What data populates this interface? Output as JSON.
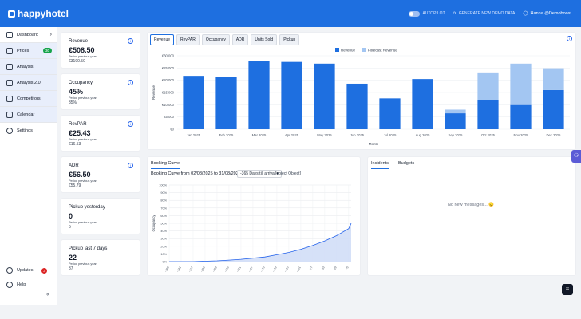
{
  "app": {
    "logo": "happyhotel"
  },
  "topbar": {
    "autopilot_label": "AUTOPILOT",
    "generate_label": "GENERATE NEW DEMO DATA",
    "user_label": "Hanna @Demoboost"
  },
  "sidebar": {
    "items": [
      {
        "label": "Dashboard",
        "icon": "dashboard-icon"
      },
      {
        "label": "Prices",
        "icon": "tag-icon",
        "badge": "30"
      },
      {
        "label": "Analysis",
        "icon": "chart-icon"
      },
      {
        "label": "Analysis 2.0",
        "icon": "chart-icon"
      },
      {
        "label": "Competitors",
        "icon": "competitors-icon"
      },
      {
        "label": "Calendar",
        "icon": "calendar-icon"
      },
      {
        "label": "Settings",
        "icon": "gear-icon"
      }
    ],
    "bottom": [
      {
        "label": "Updates",
        "badge": "3"
      },
      {
        "label": "Help"
      }
    ],
    "collapse_glyph": "«"
  },
  "kpis": [
    {
      "title": "Revenue",
      "value": "€508.50",
      "sub": "Period previous year",
      "prev": "€3190.50"
    },
    {
      "title": "Occupancy",
      "value": "45%",
      "sub": "Period previous year",
      "prev": "35%"
    },
    {
      "title": "RevPAR",
      "value": "€25.43",
      "sub": "Period previous year",
      "prev": "€16.53"
    },
    {
      "title": "ADR",
      "value": "€56.50",
      "sub": "Period previous year",
      "prev": "€55.79"
    },
    {
      "title": "Pickup yesterday",
      "value": "0",
      "sub": "Period previous year",
      "prev": "5"
    },
    {
      "title": "Pickup last 7 days",
      "value": "22",
      "sub": "Period previous year",
      "prev": "37"
    }
  ],
  "revenue_tabs": [
    "Revenue",
    "RevPAR",
    "Occupancy",
    "ADR",
    "Units Sold",
    "Pickup"
  ],
  "booking": {
    "tab": "Booking Curve",
    "title": "Booking Curve from 02/08/2025 to 31/08/2025",
    "select_value": "-365 Days till arrival",
    "object_text": "[object Object]"
  },
  "incidents": {
    "tabs": [
      "Incidents",
      "Budgets"
    ],
    "empty": "No new messages... 😞"
  },
  "chart_data": [
    {
      "type": "bar",
      "categories": [
        "Jan 2025",
        "Feb 2025",
        "Mar 2025",
        "Apr 2025",
        "May 2025",
        "Jun 2025",
        "Jul 2025",
        "Aug 2025",
        "Sep 2025",
        "Oct 2025",
        "Nov 2025",
        "Dec 2025"
      ],
      "series": [
        {
          "name": "Revenue",
          "values": [
            21800,
            21200,
            28000,
            27500,
            26800,
            18600,
            12600,
            20500,
            6500,
            11900,
            9900,
            16000
          ]
        },
        {
          "name": "Forecast Revenue",
          "values": [
            0,
            0,
            0,
            0,
            0,
            0,
            0,
            0,
            1500,
            11300,
            16900,
            8900
          ]
        }
      ],
      "xlabel": "Month",
      "ylabel": "Revenue",
      "ylim": [
        0,
        30000
      ],
      "yticks": [
        "€0",
        "€5,000",
        "€10,000",
        "€15,000",
        "€20,000",
        "€25,000",
        "€30,000"
      ],
      "colors": [
        "#1e6fe0",
        "#a3c6f2"
      ],
      "legend": "top-center",
      "stacked": true
    },
    {
      "type": "area",
      "xticks": [
        "-365",
        "-341",
        "-317",
        "-293",
        "-269",
        "-245",
        "-221",
        "-197",
        "-173",
        "-149",
        "-125",
        "-101",
        "-77",
        "-53",
        "-29",
        "-5"
      ],
      "x": [
        -365,
        -341,
        -317,
        -293,
        -269,
        -245,
        -221,
        -197,
        -173,
        -149,
        -125,
        -101,
        -77,
        -53,
        -29,
        -5,
        0
      ],
      "y": [
        0,
        0,
        0,
        0.5,
        1,
        2,
        3,
        4.5,
        6,
        9,
        12,
        16,
        21,
        27,
        34,
        43,
        50
      ],
      "ylabel": "Occupancy",
      "ylim": [
        0,
        100
      ],
      "yticks": [
        "0%",
        "10%",
        "20%",
        "30%",
        "40%",
        "50%",
        "60%",
        "70%",
        "80%",
        "90%",
        "100%"
      ],
      "grid": true,
      "colors": [
        "#2563eb",
        "#cfdcf7"
      ]
    }
  ]
}
